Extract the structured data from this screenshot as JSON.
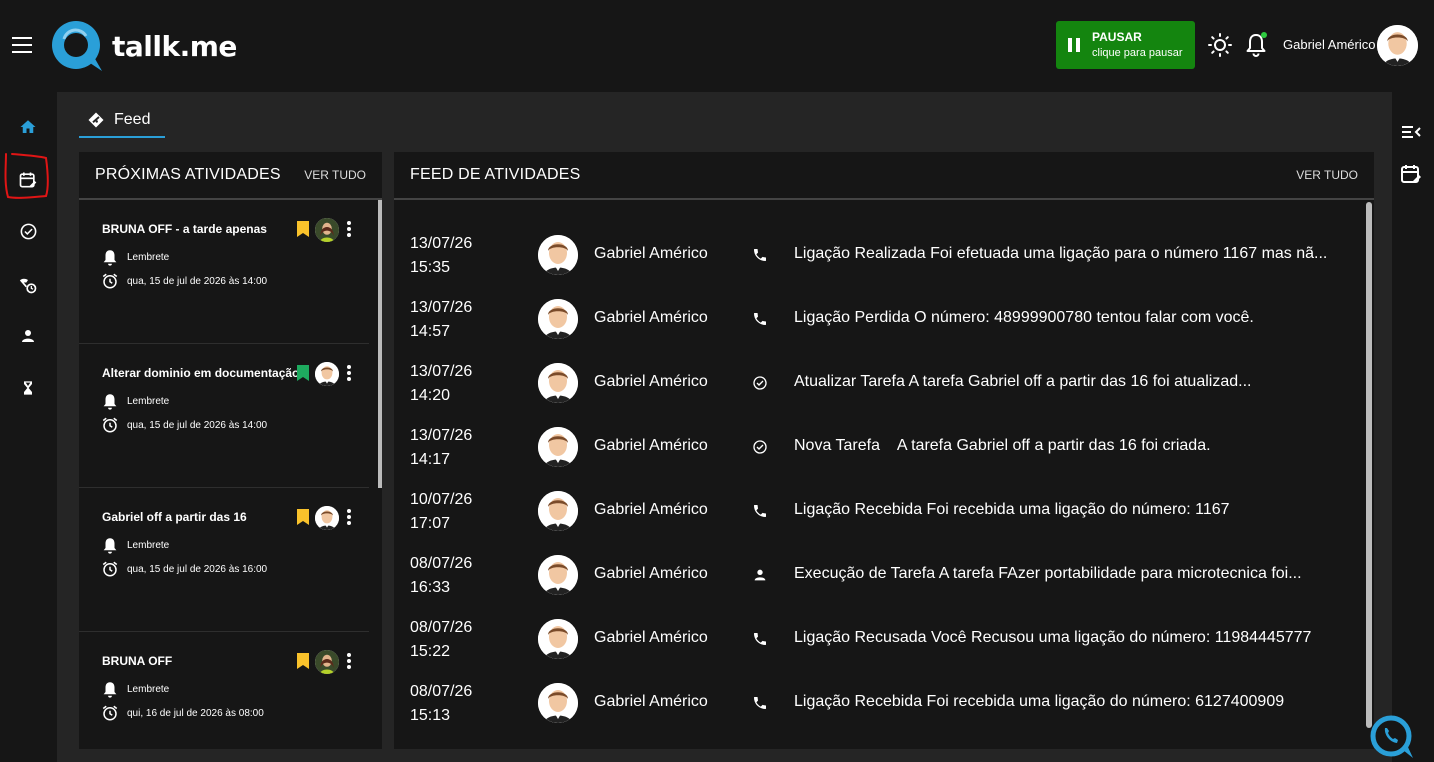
{
  "brand": {
    "logo_text": "tallk.me",
    "accent": "#2a9fd8"
  },
  "topbar": {
    "pause_title": "PAUSAR",
    "pause_sub": "clique para pausar",
    "user_name": "Gabriel Américo"
  },
  "tabs": [
    {
      "label": "Feed"
    }
  ],
  "upcoming": {
    "title": "PRÓXIMAS ATIVIDADES",
    "see_all": "VER TUDO",
    "items": [
      {
        "title": "BRUNA OFF - a tarde apenas",
        "type": "Lembrete",
        "when": "qua, 15 de jul de 2026 às 14:00",
        "tag_color": "#f9c22b"
      },
      {
        "title": "Alterar dominio em documentação",
        "type": "Lembrete",
        "when": "qua, 15 de jul de 2026 às 14:00",
        "tag_color": "#1eab5f"
      },
      {
        "title": "Gabriel off a partir das 16",
        "type": "Lembrete",
        "when": "qua, 15 de jul de 2026 às 16:00",
        "tag_color": "#f9c22b"
      },
      {
        "title": "BRUNA OFF",
        "type": "Lembrete",
        "when": "qui, 16 de jul de 2026 às 08:00",
        "tag_color": "#f9c22b"
      }
    ]
  },
  "feed": {
    "title": "FEED DE ATIVIDADES",
    "see_all": "VER TUDO",
    "rows": [
      {
        "date": "13/07/26",
        "time": "15:35",
        "user": "Gabriel Américo",
        "icon": "phone-icon",
        "text": "Ligação Realizada Foi efetuada uma ligação para o número 1167 mas nã..."
      },
      {
        "date": "13/07/26",
        "time": "14:57",
        "user": "Gabriel Américo",
        "icon": "phone-icon",
        "text": "Ligação Perdida O número: 48999900780 tentou falar com você."
      },
      {
        "date": "13/07/26",
        "time": "14:20",
        "user": "Gabriel Américo",
        "icon": "check-circle-icon",
        "text": "Atualizar Tarefa A tarefa Gabriel off a partir das 16 foi atualizad..."
      },
      {
        "date": "13/07/26",
        "time": "14:17",
        "user": "Gabriel Américo",
        "icon": "check-circle-icon",
        "text": "Nova Tarefa    A tarefa Gabriel off a partir das 16 foi criada."
      },
      {
        "date": "10/07/26",
        "time": "17:07",
        "user": "Gabriel Américo",
        "icon": "phone-icon",
        "text": "Ligação Recebida Foi recebida uma ligação do número: 1167"
      },
      {
        "date": "08/07/26",
        "time": "16:33",
        "user": "Gabriel Américo",
        "icon": "person-icon",
        "text": "Execução de Tarefa A tarefa FAzer portabilidade para microtecnica foi..."
      },
      {
        "date": "08/07/26",
        "time": "15:22",
        "user": "Gabriel Américo",
        "icon": "phone-icon",
        "text": "Ligação Recusada Você Recusou uma ligação do número: 11984445777"
      },
      {
        "date": "08/07/26",
        "time": "15:13",
        "user": "Gabriel Américo",
        "icon": "phone-icon",
        "text": "Ligação Recebida Foi recebida uma ligação do número: 6127400909"
      }
    ]
  }
}
